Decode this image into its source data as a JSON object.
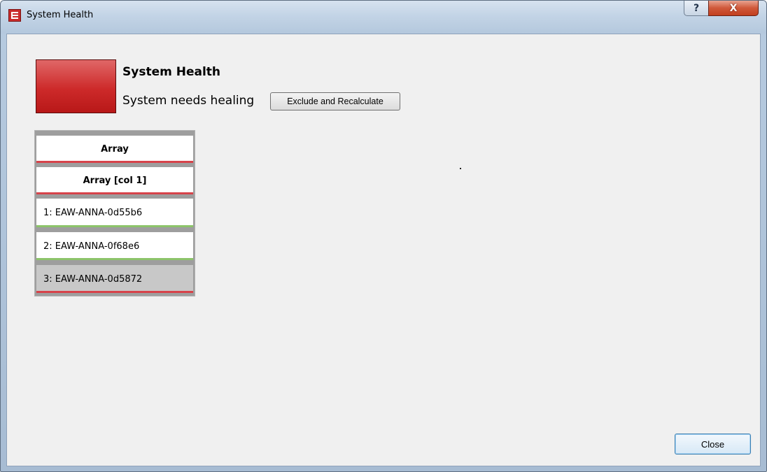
{
  "window": {
    "title": "System Health",
    "icon": "app-logo-icon",
    "help_glyph": "?",
    "close_glyph": "X"
  },
  "health": {
    "heading": "System Health",
    "status": "System needs healing",
    "status_color": "#cd2a2a",
    "exclude_button": "Exclude and Recalculate"
  },
  "tree": {
    "nodes": [
      {
        "label": "Array",
        "kind": "header",
        "status_color": "#d7434a"
      },
      {
        "label": "Array [col 1]",
        "kind": "header",
        "status_color": "#d7434a"
      },
      {
        "label": "1: EAW-ANNA-0d55b6",
        "kind": "item",
        "status_color": "#8cc46a"
      },
      {
        "label": "2: EAW-ANNA-0f68e6",
        "kind": "item",
        "status_color": "#8cc46a"
      },
      {
        "label": "3: EAW-ANNA-0d5872",
        "kind": "item",
        "status_color": "#d7434a",
        "selected": true
      }
    ]
  },
  "footer": {
    "close_button": "Close"
  }
}
